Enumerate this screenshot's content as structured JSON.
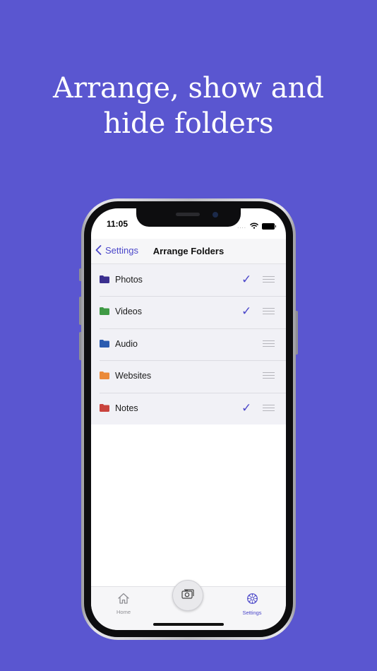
{
  "headline": "Arrange, show and\nhide folders",
  "status_bar": {
    "time": "11:05",
    "signal_dots": "...."
  },
  "nav": {
    "back_label": "Settings",
    "title": "Arrange Folders"
  },
  "folders": [
    {
      "name": "Photos",
      "color": "#3b2f8f",
      "checked": true,
      "check": "✓"
    },
    {
      "name": "Videos",
      "color": "#3f9a45",
      "checked": true,
      "check": "✓"
    },
    {
      "name": "Audio",
      "color": "#2a5bb0",
      "checked": false,
      "check": ""
    },
    {
      "name": "Websites",
      "color": "#ea8a3a",
      "checked": false,
      "check": ""
    },
    {
      "name": "Notes",
      "color": "#c9433d",
      "checked": true,
      "check": "✓"
    }
  ],
  "tabbar": {
    "home_label": "Home",
    "settings_label": "Settings"
  },
  "colors": {
    "background": "#5a56d0",
    "accent": "#4b47c9"
  }
}
